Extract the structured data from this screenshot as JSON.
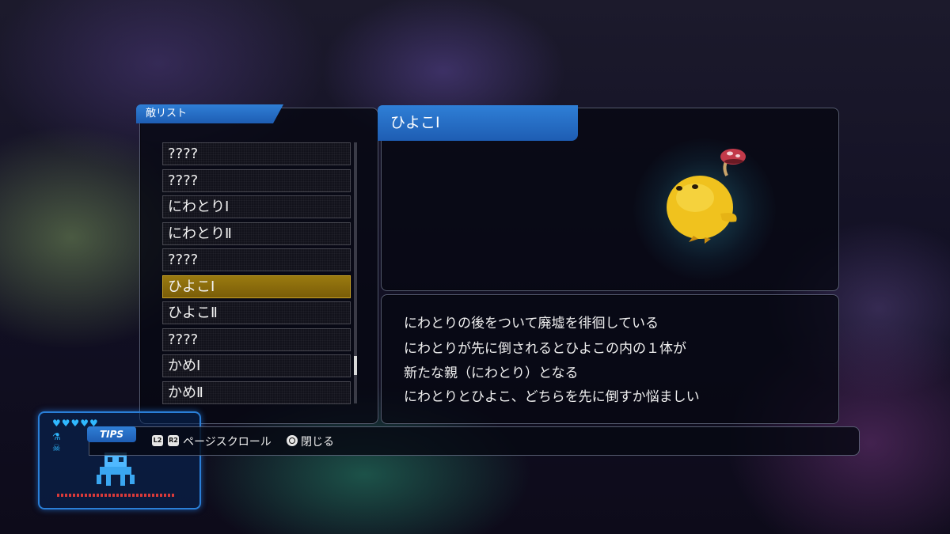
{
  "list_panel": {
    "tab_label": "敵リスト",
    "items": [
      {
        "label": "????",
        "selected": false
      },
      {
        "label": "????",
        "selected": false
      },
      {
        "label": "にわとりⅠ",
        "selected": false
      },
      {
        "label": "にわとりⅡ",
        "selected": false
      },
      {
        "label": "????",
        "selected": false
      },
      {
        "label": "ひよこⅠ",
        "selected": true
      },
      {
        "label": "ひよこⅡ",
        "selected": false
      },
      {
        "label": "????",
        "selected": false
      },
      {
        "label": "かめⅠ",
        "selected": false
      },
      {
        "label": "かめⅡ",
        "selected": false
      }
    ]
  },
  "detail": {
    "name": "ひよこⅠ",
    "description": [
      "にわとりの後をついて廃墟を徘徊している",
      "にわとりが先に倒されるとひよこの内の１体が",
      "新たな親（にわとり）となる",
      "にわとりとひよこ、どちらを先に倒すか悩ましい"
    ]
  },
  "tips_bar": {
    "tab_label": "TIPS",
    "l2_label": "L2",
    "r2_label": "R2",
    "scroll_label": "ページスクロール",
    "close_label": "閉じる"
  },
  "colors": {
    "accent_blue": "#2f7fd6",
    "selected_gold": "#8a6a0c",
    "creature_yellow": "#f0c21e"
  },
  "icons": [
    "l2-button-icon",
    "r2-button-icon",
    "circle-button-icon",
    "heart-icon"
  ]
}
